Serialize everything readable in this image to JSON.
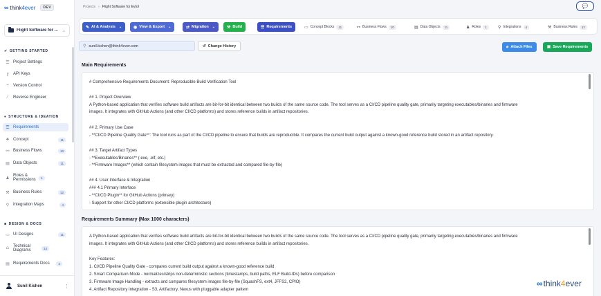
{
  "brand": {
    "logo_mark": "∞",
    "name_part1": "think",
    "name_part2": "4ever",
    "badge": "DEV"
  },
  "project_select": {
    "name": "Flight Software for ...",
    "chevron": "⌄"
  },
  "sidebar": {
    "getting_started": {
      "heading": "GETTING STARTED",
      "items": [
        {
          "label": "Project Settings",
          "icon": "settings-icon"
        },
        {
          "label": "API Keys",
          "icon": "key-icon"
        },
        {
          "label": "Version Control",
          "icon": "branch-icon"
        },
        {
          "label": "Reverse Engineer",
          "icon": "wand-icon"
        }
      ]
    },
    "structure": {
      "heading": "STRUCTURE & IDEATION",
      "items": [
        {
          "label": "Requirements",
          "icon": "list-icon",
          "count": ""
        },
        {
          "label": "Concept",
          "icon": "shapes-icon",
          "count": "11"
        },
        {
          "label": "Business Flows",
          "icon": "flow-icon",
          "count": "10"
        },
        {
          "label": "Data Objects",
          "icon": "database-icon",
          "count": "11"
        },
        {
          "label": "Roles & Permissions",
          "icon": "users-icon",
          "count": "1"
        },
        {
          "label": "Business Rules",
          "icon": "gavel-icon",
          "count": "12"
        },
        {
          "label": "Integration Maps",
          "icon": "plug-icon",
          "count": "4"
        }
      ]
    },
    "design": {
      "heading": "DESIGN & DOCS",
      "items": [
        {
          "label": "UI Designs",
          "icon": "monitor-icon",
          "count": "11"
        },
        {
          "label": "Technical Diagrams",
          "icon": "diagram-icon",
          "count": "14"
        },
        {
          "label": "Requirements Docs",
          "icon": "document-icon",
          "count": "2"
        }
      ]
    },
    "user": {
      "name": "Sunil Kishen",
      "menu": "⋮"
    }
  },
  "breadcrumb": {
    "root": "Projects",
    "sep": "›",
    "current": "Flight Software for Evtol"
  },
  "toolbar": {
    "ai": "AI & Analysis",
    "view": "View & Export",
    "migration": "Migration",
    "build": "Build",
    "requirements": "Requirements",
    "tabs": [
      {
        "label": "Concept Blocks",
        "count": "11"
      },
      {
        "label": "Business Flows",
        "count": "10"
      },
      {
        "label": "Data Objects",
        "count": "11"
      },
      {
        "label": "Roles",
        "count": "1"
      },
      {
        "label": "Integrations",
        "count": "4"
      },
      {
        "label": "Business Rules",
        "count": "12"
      }
    ]
  },
  "search": {
    "value": "sunil.kishen@think4ever.com"
  },
  "actions": {
    "change_history": "Change History",
    "attach": "Attach Files",
    "save": "Save Requirements"
  },
  "main_requirements": {
    "title": "Main Requirements",
    "lines": [
      "# Comprehensive Requirements Document: Reproducible Build Verification Tool",
      "",
      "## 1. Project Overview",
      "A Python-based application that verifies software build artifacts are bit-for-bit identical between two builds of the same source code. The tool serves as a CI/CD pipeline quality gate, primarily targeting executables/binaries and firmware",
      "images. It integrates with GitHub Actions (and other CI/CD platforms) and stores reference builds in artifact repositories.",
      "",
      "## 2. Primary Use Case",
      "- **CI/CD Pipeline Quality Gate**: The tool runs as part of the CI/CD pipeline to ensure that builds are reproducible. It compares the current build output against a known-good reference build stored in an artifact repository.",
      "",
      "## 3. Target Artifact Types",
      "- **Executables/Binaries** (.exe, .elf, etc.)",
      "- **Firmware Images** (which contain filesystem images that must be extracted and compared file-by-file)",
      "",
      "## 4. User Interface & Integration",
      "### 4.1 Primary Interface",
      "- **CI/CD Plugin** for GitHub Actions (primary)",
      "- Support for other CI/CD platforms (extensible plugin architecture)"
    ]
  },
  "summary": {
    "title": "Requirements Summary (Max 1000 characters)",
    "lines": [
      "A Python-based application that verifies software build artifacts are bit-for-bit identical between two builds of the same source code. The tool serves as a CI/CD pipeline quality gate, primarily targeting executables/binaries and firmware",
      "images. It integrates with GitHub Actions (and other CI/CD platforms) and stores reference builds in artifact repositories.",
      "",
      "Key Features:",
      "1. CI/CD Pipeline Quality Gate - compares current build output against a known-good reference build",
      "2. Smart Comparison Mode - normalizes/strips non-deterministic sections (timestamps, build paths, ELF Build-IDs) before comparison",
      "3. Firmware Image Handling - extracts and compares filesystem images file-by-file (SquashFS, ext4, JFFS2, CPIO)",
      "4. Artifact Repository Integration - S3, Artifactory, Nexus with pluggable adapter pattern"
    ]
  },
  "watermark": {
    "mark": "∞",
    "part1": "think",
    "part2": "4",
    "part3": "ever"
  },
  "colors": {
    "accent": "#3d50c3",
    "build": "#23b14d",
    "save": "#19a85a",
    "attach": "#3c8ce7",
    "brand": "#1f6fd1"
  }
}
